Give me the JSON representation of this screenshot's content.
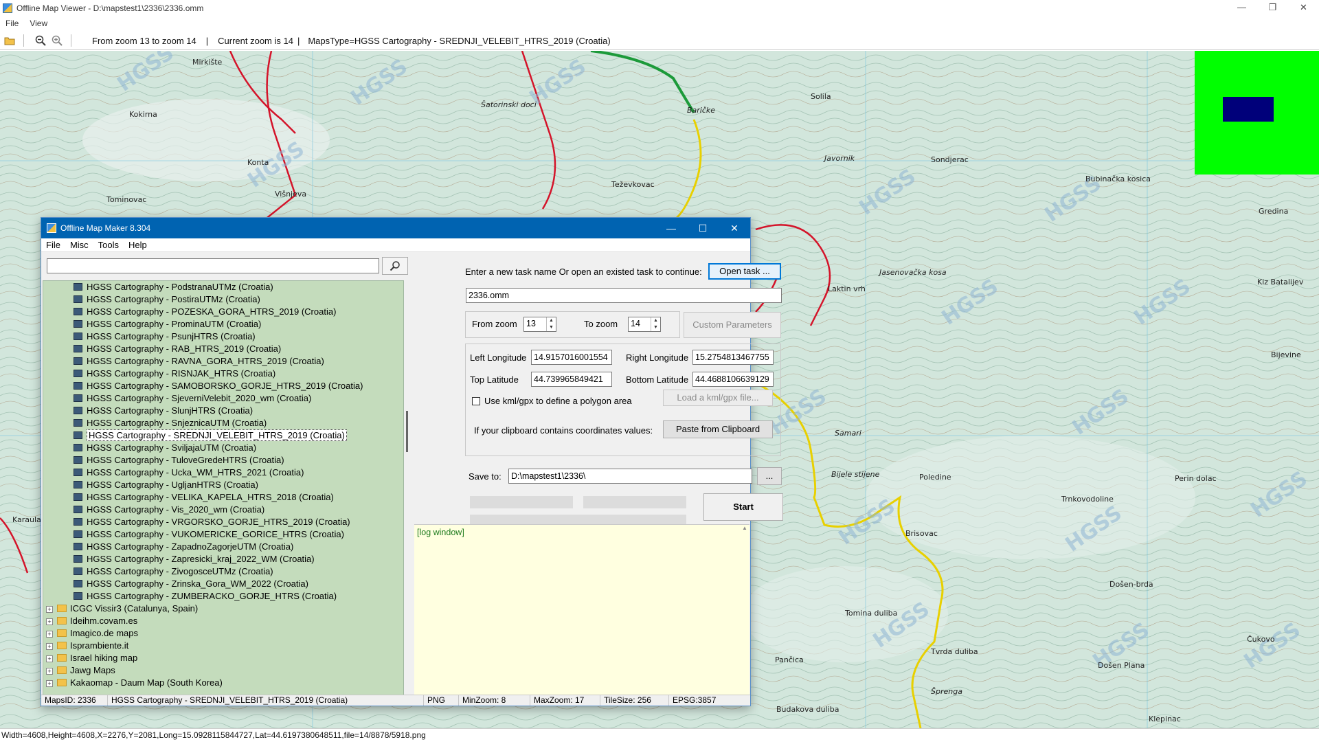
{
  "viewer": {
    "title": "Offline Map Viewer - D:\\mapstest1\\2336\\2336.omm",
    "menu": [
      "File",
      "View"
    ],
    "toolbar": {
      "zoom_range": "From zoom 13 to zoom 14",
      "current_zoom": "Current zoom is 14",
      "maps_type": "MapsType=HGSS Cartography - SREDNJI_VELEBIT_HTRS_2019 (Croatia)"
    },
    "status": "Width=4608,Height=4608,X=2276,Y=2081,Long=15.0928115844727,Lat=44.6197380648511,file=14/8878/5918.png"
  },
  "map": {
    "watermark": "HGSS",
    "place_labels": [
      "Mirkište",
      "Kokirna",
      "Konta",
      "Tominovac",
      "Višnjeva",
      "Šatorinski doci",
      "Teževkovac",
      "Baričke",
      "Solila",
      "Javornik",
      "Sondjerac",
      "Bubinačka kosica",
      "Laktin vrh",
      "Jasenovačka kosa",
      "Samari",
      "Bijele stijene",
      "Poledine",
      "Brisovac",
      "Trnkovodoline",
      "Perin dolac",
      "Došen-brda",
      "Tomina duliba",
      "Tvrda duliba",
      "Došen Plana",
      "Budakova duliba",
      "Šprenga",
      "Klepinac",
      "Gredina",
      "Kiz Batalijev",
      "Čukovo",
      "Bijevine",
      "Pančica",
      "Karaula"
    ],
    "colors": {
      "base": "#cfe3da",
      "route_red": "#d4142a",
      "route_yellow": "#e8d000",
      "road_green": "#1c9a3a",
      "contour": "#b48a60"
    }
  },
  "minimap": {
    "bg": "#00ff00",
    "viewport": "#00007a"
  },
  "dialog": {
    "title": "Offline Map Maker 8.304",
    "menu": [
      "File",
      "Misc",
      "Tools",
      "Help"
    ],
    "search_placeholder": "",
    "tree_children": [
      "HGSS Cartography - PodstranaUTMz (Croatia)",
      "HGSS Cartography - PostiraUTMz (Croatia)",
      "HGSS Cartography - POZESKA_GORA_HTRS_2019 (Croatia)",
      "HGSS Cartography - ProminaUTM (Croatia)",
      "HGSS Cartography - PsunjHTRS (Croatia)",
      "HGSS Cartography - RAB_HTRS_2019 (Croatia)",
      "HGSS Cartography - RAVNA_GORA_HTRS_2019 (Croatia)",
      "HGSS Cartography - RISNJAK_HTRS (Croatia)",
      "HGSS Cartography - SAMOBORSKO_GORJE_HTRS_2019 (Croatia)",
      "HGSS Cartography - SjeverniVelebit_2020_wm (Croatia)",
      "HGSS Cartography - SlunjHTRS (Croatia)",
      "HGSS Cartography - SnjeznicaUTM (Croatia)",
      "HGSS Cartography - SREDNJI_VELEBIT_HTRS_2019 (Croatia)",
      "HGSS Cartography - SviljajaUTM (Croatia)",
      "HGSS Cartography - TuloveGredeHTRS (Croatia)",
      "HGSS Cartography - Ucka_WM_HTRS_2021 (Croatia)",
      "HGSS Cartography - UgljanHTRS (Croatia)",
      "HGSS Cartography - VELIKA_KAPELA_HTRS_2018 (Croatia)",
      "HGSS Cartography - Vis_2020_wm (Croatia)",
      "HGSS Cartography - VRGORSKO_GORJE_HTRS_2019 (Croatia)",
      "HGSS Cartography - VUKOMERICKE_GORICE_HTRS (Croatia)",
      "HGSS Cartography - ZapadnoZagorjeUTM (Croatia)",
      "HGSS Cartography - Zapresicki_kraj_2022_WM (Croatia)",
      "HGSS Cartography - ZivogosceUTMz (Croatia)",
      "HGSS Cartography - Zrinska_Gora_WM_2022 (Croatia)",
      "HGSS Cartography - ZUMBERACKO_GORJE_HTRS (Croatia)"
    ],
    "selected_index": 12,
    "tree_folders": [
      "ICGC Vissir3 (Catalunya, Spain)",
      "Ideihm.covam.es",
      "Imagico.de maps",
      "Isprambiente.it",
      "Israel hiking map",
      "Jawg Maps",
      "Kakaomap - Daum Map (South Korea)"
    ],
    "task_prompt": "Enter a new task name Or open an existed task to continue:",
    "open_task": "Open task ...",
    "task_name": "2336.omm",
    "from_zoom_label": "From zoom",
    "from_zoom": "13",
    "to_zoom_label": "To zoom",
    "to_zoom": "14",
    "custom_params": "Custom Parameters",
    "left_lon_label": "Left Longitude",
    "left_lon": "14.9157016001554",
    "right_lon_label": "Right Longitude",
    "right_lon": "15.2754813467755",
    "top_lat_label": "Top Latitude",
    "top_lat": "44.739965849421",
    "bottom_lat_label": "Bottom Latitude",
    "bottom_lat": "44.4688106639129",
    "kml_label": "Use kml/gpx to define a polygon area",
    "load_kml": "Load a kml/gpx file...",
    "clipboard_label": "If your clipboard contains coordinates values:",
    "paste_clipboard": "Paste from Clipboard",
    "save_to_label": "Save to:",
    "save_to": "D:\\mapstest1\\2336\\",
    "browse": "...",
    "start": "Start",
    "log": "[log window]",
    "status": {
      "maps_id": "MapsID: 2336",
      "map_name": "HGSS Cartography - SREDNJI_VELEBIT_HTRS_2019 (Croatia)",
      "format": "PNG",
      "min_zoom": "MinZoom: 8",
      "max_zoom": "MaxZoom: 17",
      "tile_size": "TileSize: 256",
      "epsg": "EPSG:3857"
    }
  }
}
